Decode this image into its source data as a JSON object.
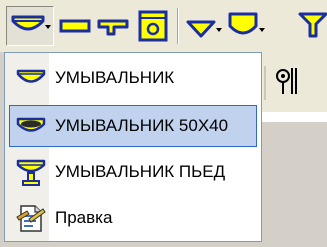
{
  "toolbar": {
    "buttons": [
      {
        "name": "washbasin-tool-button",
        "icon": "washbasin-dropdown-icon",
        "pressed": true
      },
      {
        "name": "rect-fixture-button",
        "icon": "rect-fixture-icon"
      },
      {
        "name": "l-fixture-button",
        "icon": "l-fixture-icon"
      },
      {
        "name": "square-fixture-button",
        "icon": "square-fixture-icon"
      },
      {
        "name": "triangle-fixture-button",
        "icon": "triangle-fixture-icon"
      },
      {
        "name": "shield-fixture-button",
        "icon": "shield-fixture-icon"
      },
      {
        "name": "y-fixture-button",
        "icon": "y-fixture-icon"
      }
    ],
    "accent_yellow": "#ffff00",
    "accent_outline": "#1a2ea0"
  },
  "menu": {
    "items": [
      {
        "label": "УМЫВАЛЬНИК",
        "icon": "washbasin-icon"
      },
      {
        "label": "УМЫВАЛЬНИК 50X40",
        "icon": "washbasin-50x40-icon",
        "highlighted": true
      },
      {
        "label": "УМЫВАЛЬНИК ПЬЕД",
        "icon": "pedestal-washbasin-icon"
      },
      {
        "label": "Правка",
        "icon": "edit-document-icon"
      }
    ],
    "highlight_color": "#c1d2ee",
    "highlight_border": "#316ac5"
  }
}
